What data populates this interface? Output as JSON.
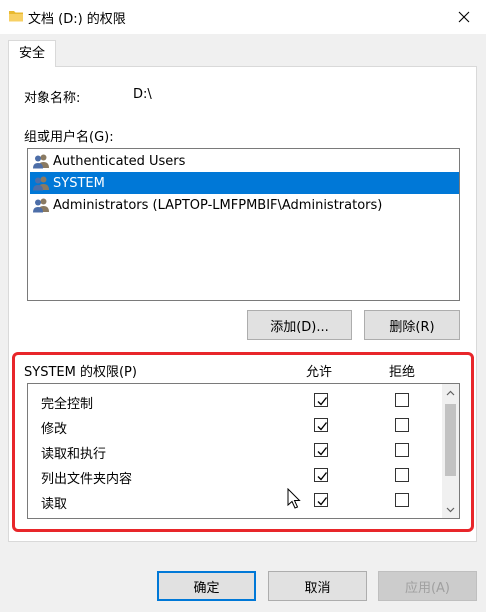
{
  "window": {
    "title": "文档 (D:) 的权限",
    "close_label": "关闭"
  },
  "tab": {
    "label": "安全"
  },
  "object": {
    "label": "对象名称:",
    "value": "D:\\"
  },
  "groups": {
    "label": "组或用户名(G):",
    "items": [
      {
        "label": "Authenticated Users",
        "selected": false
      },
      {
        "label": "SYSTEM",
        "selected": true
      },
      {
        "label": "Administrators (LAPTOP-LMFPMBIF\\Administrators)",
        "selected": false
      }
    ]
  },
  "buttons": {
    "add": "添加(D)...",
    "remove": "删除(R)",
    "ok": "确定",
    "cancel": "取消",
    "apply": "应用(A)"
  },
  "permissions": {
    "header": "SYSTEM 的权限(P)",
    "allow_col": "允许",
    "deny_col": "拒绝",
    "items": [
      {
        "name": "完全控制",
        "allow": true,
        "deny": false
      },
      {
        "name": "修改",
        "allow": true,
        "deny": false
      },
      {
        "name": "读取和执行",
        "allow": true,
        "deny": false
      },
      {
        "name": "列出文件夹内容",
        "allow": true,
        "deny": false
      },
      {
        "name": "读取",
        "allow": true,
        "deny": false
      }
    ]
  },
  "colors": {
    "selection": "#0078d7",
    "highlight_frame": "#e8262a",
    "default_button_border": "#0078d7"
  }
}
